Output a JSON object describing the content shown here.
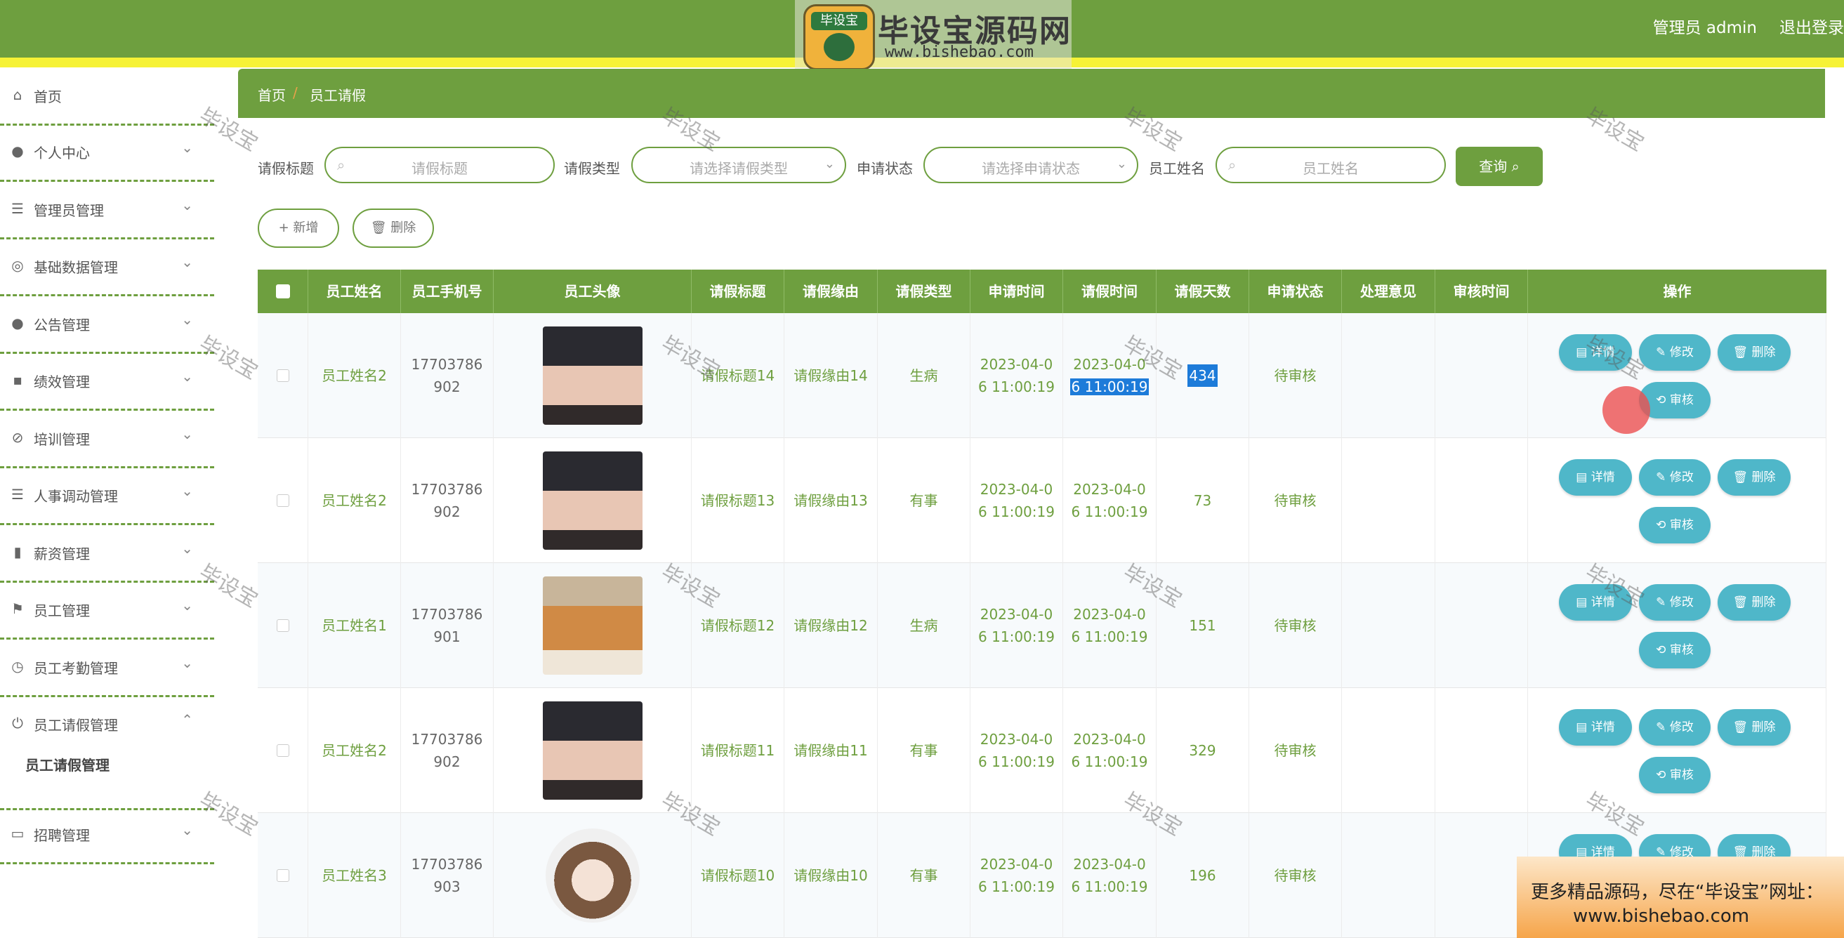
{
  "header": {
    "brand_badge": "毕设宝",
    "brand_title": "毕设宝源码网",
    "brand_url": "www.bishebao.com",
    "admin": "管理员 admin",
    "logout": "退出登录"
  },
  "sidebar": {
    "items": [
      {
        "label": "首页",
        "icon": "home-icon"
      },
      {
        "label": "个人中心",
        "icon": "user-icon"
      },
      {
        "label": "管理员管理",
        "icon": "list-icon"
      },
      {
        "label": "基础数据管理",
        "icon": "database-icon"
      },
      {
        "label": "公告管理",
        "icon": "bulb-icon"
      },
      {
        "label": "绩效管理",
        "icon": "chat-icon"
      },
      {
        "label": "培训管理",
        "icon": "compass-icon"
      },
      {
        "label": "人事调动管理",
        "icon": "list-icon"
      },
      {
        "label": "薪资管理",
        "icon": "bar-chart-icon"
      },
      {
        "label": "员工管理",
        "icon": "flag-icon"
      },
      {
        "label": "员工考勤管理",
        "icon": "clock-icon"
      },
      {
        "label": "员工请假管理",
        "icon": "power-icon"
      },
      {
        "label": "招聘管理",
        "icon": "card-icon"
      }
    ],
    "sub_item": "员工请假管理"
  },
  "breadcrumb": {
    "home": "首页",
    "sep": "/",
    "current": "员工请假"
  },
  "search": {
    "title_label": "请假标题",
    "title_placeholder": "请假标题",
    "type_label": "请假类型",
    "type_placeholder": "请选择请假类型",
    "status_label": "申请状态",
    "status_placeholder": "请选择申请状态",
    "name_label": "员工姓名",
    "name_placeholder": "员工姓名",
    "query": "查询 ⌕"
  },
  "toolbar": {
    "add": "+ 新增",
    "delete": "🗑 删除"
  },
  "table": {
    "headers": [
      "员工姓名",
      "员工手机号",
      "员工头像",
      "请假标题",
      "请假缘由",
      "请假类型",
      "申请时间",
      "请假时间",
      "请假天数",
      "申请状态",
      "处理意见",
      "审核时间",
      "操作"
    ],
    "rows": [
      {
        "name": "员工姓名2",
        "phone1": "17703786",
        "phone2": "902",
        "avatar": "girl",
        "title": "请假标题14",
        "reason": "请假缘由14",
        "type": "生病",
        "apply1": "2023-04-0",
        "apply2": "6 11:00:19",
        "leave1": "2023-04-0",
        "leave2": "6 11:00:19",
        "days": "434",
        "status": "待审核"
      },
      {
        "name": "员工姓名2",
        "phone1": "17703786",
        "phone2": "902",
        "avatar": "girl",
        "title": "请假标题13",
        "reason": "请假缘由13",
        "type": "有事",
        "apply1": "2023-04-0",
        "apply2": "6 11:00:19",
        "leave1": "2023-04-0",
        "leave2": "6 11:00:19",
        "days": "73",
        "status": "待审核"
      },
      {
        "name": "员工姓名1",
        "phone1": "17703786",
        "phone2": "901",
        "avatar": "dog",
        "title": "请假标题12",
        "reason": "请假缘由12",
        "type": "生病",
        "apply1": "2023-04-0",
        "apply2": "6 11:00:19",
        "leave1": "2023-04-0",
        "leave2": "6 11:00:19",
        "days": "151",
        "status": "待审核"
      },
      {
        "name": "员工姓名2",
        "phone1": "17703786",
        "phone2": "902",
        "avatar": "girl",
        "title": "请假标题11",
        "reason": "请假缘由11",
        "type": "有事",
        "apply1": "2023-04-0",
        "apply2": "6 11:00:19",
        "leave1": "2023-04-0",
        "leave2": "6 11:00:19",
        "days": "329",
        "status": "待审核"
      },
      {
        "name": "员工姓名3",
        "phone1": "17703786",
        "phone2": "903",
        "avatar": "drawn",
        "title": "请假标题10",
        "reason": "请假缘由10",
        "type": "有事",
        "apply1": "2023-04-0",
        "apply2": "6 11:00:19",
        "leave1": "2023-04-0",
        "leave2": "6 11:00:19",
        "days": "196",
        "status": "待审核"
      }
    ],
    "ops": {
      "detail": "▤ 详情",
      "edit": "✎ 修改",
      "delete": "🗑 删除",
      "audit": "⟲ 审核"
    }
  },
  "watermark": "毕设宝",
  "banner": {
    "line1": "更多精品源码，尽在“毕设宝”网址：",
    "line2": "www.bishebao.com"
  }
}
